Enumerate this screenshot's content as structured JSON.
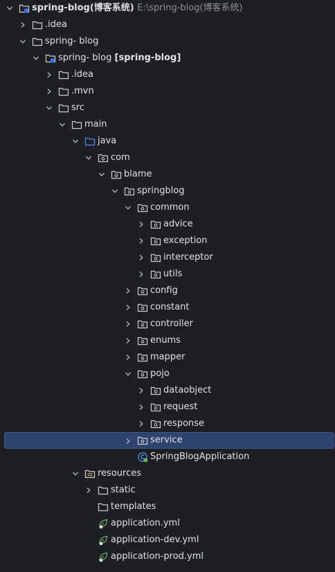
{
  "tree": {
    "root": {
      "label": "spring-blog(博客系统)",
      "path": "E:\\spring-blog(博客系统)"
    },
    "idea_root": {
      "label": ".idea"
    },
    "spring_blog_folder": {
      "label": "spring- blog"
    },
    "module": {
      "label": "spring- blog",
      "module_tag": "[spring-blog]"
    },
    "idea": {
      "label": ".idea"
    },
    "mvn": {
      "label": ".mvn"
    },
    "src": {
      "label": "src"
    },
    "main": {
      "label": "main"
    },
    "java": {
      "label": "java"
    },
    "com": {
      "label": "com"
    },
    "blame": {
      "label": "blame"
    },
    "springblog": {
      "label": "springblog"
    },
    "common": {
      "label": "common"
    },
    "advice": {
      "label": "advice"
    },
    "exception": {
      "label": "exception"
    },
    "interceptor": {
      "label": "interceptor"
    },
    "utils": {
      "label": "utils"
    },
    "config": {
      "label": "config"
    },
    "constant": {
      "label": "constant"
    },
    "controller": {
      "label": "controller"
    },
    "enums": {
      "label": "enums"
    },
    "mapper": {
      "label": "mapper"
    },
    "pojo": {
      "label": "pojo"
    },
    "dataobject": {
      "label": "dataobject"
    },
    "request": {
      "label": "request"
    },
    "response": {
      "label": "response"
    },
    "service": {
      "label": "service"
    },
    "app_class": {
      "label": "SpringBlogApplication"
    },
    "resources": {
      "label": "resources"
    },
    "static": {
      "label": "static"
    },
    "templates": {
      "label": "templates"
    },
    "app_yml": {
      "label": "application.yml"
    },
    "app_dev_yml": {
      "label": "application-dev.yml"
    },
    "app_prod_yml": {
      "label": "application-prod.yml"
    }
  }
}
